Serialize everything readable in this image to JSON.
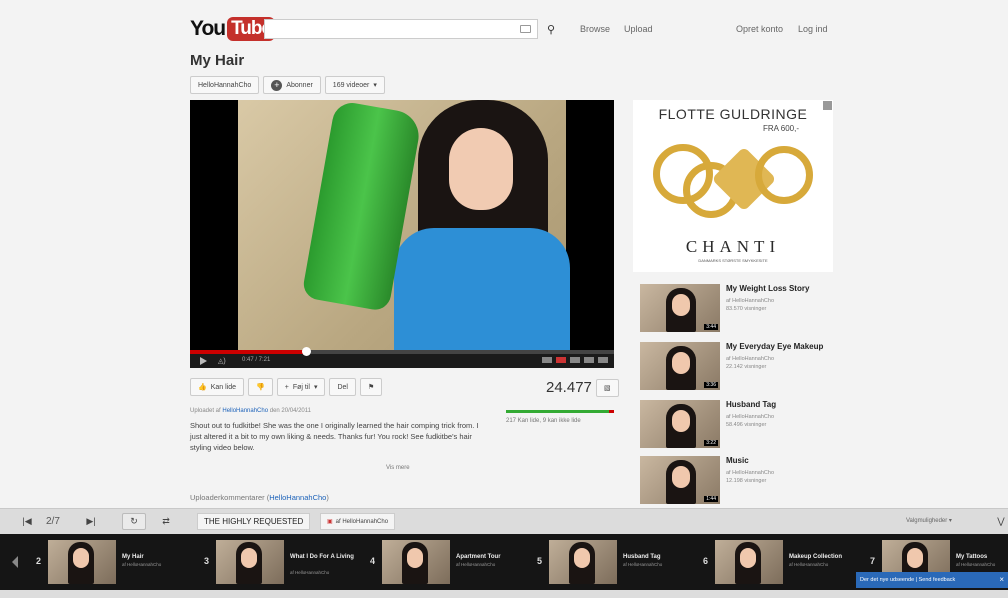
{
  "header": {
    "logo_you": "You",
    "logo_tube": "Tube",
    "search_placeholder": "",
    "browse": "Browse",
    "upload": "Upload",
    "create_account": "Opret konto",
    "login": "Log ind"
  },
  "video": {
    "title": "My Hair",
    "channel_button": "HelloHannahCho",
    "subscribe": "Abonner",
    "videos_button": "169 videoer",
    "time": "0:47 / 7:21",
    "progress": 0.27,
    "views": "24.477",
    "like": "Kan lide",
    "add_to": "Føj til",
    "share": "Del",
    "views_btn": "â ",
    "uploader_line_prefix": "Uploadet af ",
    "uploader_link": "HelloHannahCho",
    "uploader_line_suffix": " den 20/04/2011",
    "description": "Shout out to fudkitbe! She was the one I originally learned the hair comping trick from. I just altered it a bit to my own liking & needs. Thanks fur! You rock! See fudkitbe's hair styling video below.",
    "ratings": "217 Kan lide, 9 kan ikke lide",
    "ratio": 0.95,
    "more": "Vis mere",
    "comments_prefix": "Uploaderkommentarer (",
    "comments_link": "HelloHannahCho",
    "comments_suffix": ")"
  },
  "ad": {
    "title": "FLOTTE GULDRINGE",
    "price": "FRA 600,-",
    "brand": "CHANTI",
    "tagline": "DANMARKS STØRSTE SMYKKESITE"
  },
  "related": [
    {
      "title": "My Weight Loss Story",
      "by": "af HelloHannahCho",
      "views": "83.570 visninger",
      "duration": "3:44"
    },
    {
      "title": "My Everyday Eye Makeup",
      "by": "af HelloHannahCho",
      "views": "22.142 visninger",
      "duration": "3:36"
    },
    {
      "title": "Husband Tag",
      "by": "af HelloHannahCho",
      "views": "58.496 visninger",
      "duration": "3:22"
    },
    {
      "title": "Music",
      "by": "af HelloHannahCho",
      "views": "12.198 visninger",
      "duration": "1:44"
    }
  ],
  "playlist_bar": {
    "position": "2/7",
    "name": "THE HIGHLY REQUESTED",
    "by": "af HelloHannahCho",
    "options": "Valgmuligheder"
  },
  "playlist": [
    {
      "num": "2",
      "title": "My Hair",
      "sub": "af HelloHannahCho"
    },
    {
      "num": "3",
      "title": "What I Do For A Living",
      "sub": "af HelloHannahCho"
    },
    {
      "num": "4",
      "title": "Apartment Tour",
      "sub": "af HelloHannahCho"
    },
    {
      "num": "5",
      "title": "Husband Tag",
      "sub": "af HelloHannahCho"
    },
    {
      "num": "6",
      "title": "Makeup Collection",
      "sub": "af HelloHannahCho"
    },
    {
      "num": "7",
      "title": "My Tattoos",
      "sub": "af HelloHannahCho"
    }
  ],
  "feedback": "Der det nye udseende | Send feedback"
}
